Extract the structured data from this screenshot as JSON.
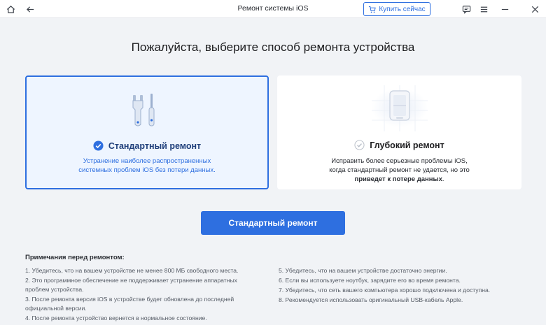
{
  "window": {
    "title": "Ремонт системы iOS",
    "buy_label": "Купить сейчас"
  },
  "heading": "Пожалуйста, выберите способ ремонта устройства",
  "cards": [
    {
      "title": "Стандартный ремонт",
      "desc_line1": "Устранение наиболее распространенных",
      "desc_line2": "системных проблем iOS без потери данных.",
      "selected": true
    },
    {
      "title": "Глубокий ремонт",
      "desc_line1": "Исправить более серьезные проблемы iOS,",
      "desc_line2": "когда стандартный ремонт не удается, но это",
      "desc_bold": "приведет к потере данных",
      "desc_end": ".",
      "selected": false
    }
  ],
  "action_button": "Стандартный ремонт",
  "notes": {
    "title": "Примечания перед ремонтом:",
    "left": [
      "1.  Убедитесь, что на вашем устройстве не менее 800 МБ свободного места.",
      "2.  Это программное обеспечение не поддерживает устранение аппаратных проблем устройства.",
      "3.  После ремонта версия iOS в устройстве будет обновлена до последней официальной версии.",
      "4.  После ремонта устройство вернется в нормальное состояние."
    ],
    "right": [
      "5.  Убедитесь, что на вашем устройстве достаточно энергии.",
      "6.  Если вы используете ноутбук, зарядите его во время ремонта.",
      "7.  Убедитесь, что сеть вашего компьютера хорошо подключена и доступна.",
      "8.  Рекомендуется использовать оригинальный USB-кабель Apple."
    ]
  },
  "colors": {
    "accent": "#2e6fe0",
    "background": "#f1f3f6",
    "selected_card": "#eef5ff"
  },
  "icons": [
    "home-icon",
    "back-arrow-icon",
    "cart-icon",
    "feedback-icon",
    "menu-icon",
    "minimize-icon",
    "close-icon",
    "wrench-screwdriver-icon",
    "device-icon",
    "check-circle-icon"
  ]
}
